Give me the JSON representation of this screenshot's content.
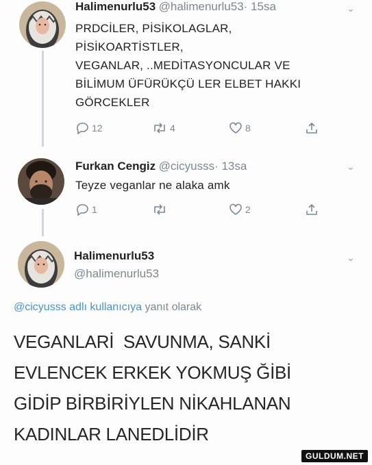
{
  "tweet1": {
    "name": "Halimenurlu53",
    "handle": "@halimenurlu53",
    "time": "· 15sa",
    "body": "PRDCİLER, PİSİKOLAGLAR, PİSİKOARTİSTLER, VEGANLAR, ..MEDİTASYONCULAR VE BİLİMUM ÜFÜRÜKÇÜ LER ELBET HAKKI GÖRCEKLER",
    "lines": [
      "PRDCİLER, PİSİKOLAGLAR,",
      "PİSİKOARTİSTLER,",
      "VEGANLAR, ..MEDİTASYONCULAR VE",
      "BİLİMUM ÜFÜRÜKÇÜ LER ELBET HAKKI",
      "GÖRCEKLER"
    ],
    "replies": "12",
    "retweets": "4",
    "likes": "8"
  },
  "tweet2": {
    "name": "Furkan Cengiz",
    "handle": "@cicyusss",
    "time": "· 13sa",
    "body": "Teyze veganlar ne alaka amk",
    "replies": "1",
    "retweets": "",
    "likes": "2"
  },
  "tweet3": {
    "name": "Halimenurlu53",
    "handle": "@halimenurlu53",
    "reply_mention": "@cicyusss adlı kullanıcıya",
    "reply_suffix": "yanıt olarak",
    "lines": [
      "VEGANLARİ  SAVUNMA, SANKİ",
      "EVLENCEK ERKEK YOKMUŞ ĞİBİ",
      "GİDİP BİRBİRİYLEN NİKAHLANAN",
      "KADINLAR LANEDLİDİR"
    ]
  },
  "watermark": "GULDUM.NET",
  "icons": {
    "reply": "reply-icon",
    "retweet": "retweet-icon",
    "like": "heart-icon",
    "share": "share-icon",
    "menu": "chevron-down-icon"
  },
  "colors": {
    "link": "#4a93c8",
    "muted": "#7b8893",
    "thread": "#cfd6dc"
  }
}
